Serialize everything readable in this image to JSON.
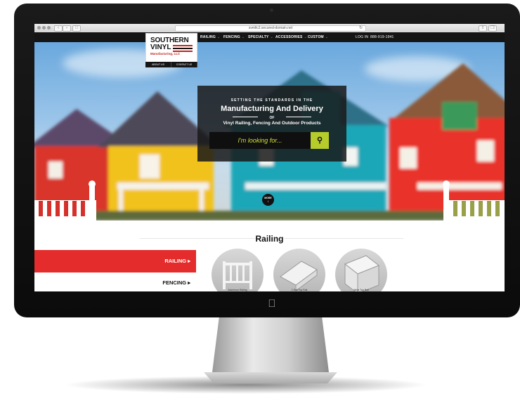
{
  "browser": {
    "url": "svmllc2.secured-domain.net"
  },
  "logo": {
    "line1": "SOUTHERN",
    "line2": "VINYL",
    "line3": "Manufacturing, LLC"
  },
  "header": {
    "sublinks": [
      "ABOUT US",
      "CONTACT US"
    ],
    "nav": [
      "RAILING",
      "FENCING",
      "SPECIALTY",
      "ACCESSORIES",
      "CUSTOM"
    ],
    "login": "LOG IN",
    "phone": "888-919-1941"
  },
  "hero": {
    "line1": "SETTING THE STANDARDS IN THE",
    "line2": "Manufacturing And Delivery",
    "line3": "OF",
    "line4": "Vinyl Railing, Fencing And Outdoor Products",
    "search_placeholder": "I'm looking for...",
    "more_label": "MORE"
  },
  "content": {
    "section_title": "Railing",
    "sidebar": [
      "RAILING ▸",
      "FENCING ▸"
    ],
    "products": [
      "Aluminum Railing",
      "2-Rail Top Rail",
      "Wide Top Rail"
    ]
  },
  "colors": {
    "accent_red": "#e32c2b",
    "search_green": "#b6cc2b",
    "nav_black": "#151515"
  },
  "icons": [
    "search-icon",
    "chevron-down-icon",
    "apple-logo-icon"
  ]
}
